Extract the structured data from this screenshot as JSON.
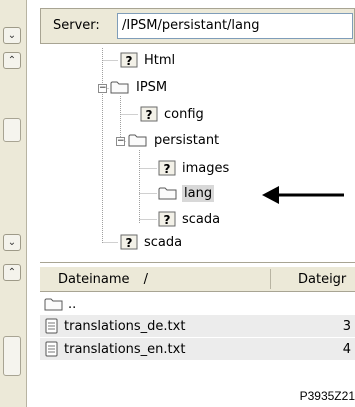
{
  "server": {
    "label": "Server:",
    "path": "/IPSM/persistant/lang"
  },
  "tree": {
    "items": [
      {
        "label": "Html",
        "icon": "unknown-type-icon"
      },
      {
        "label": "IPSM",
        "icon": "folder-icon",
        "expanded": true
      },
      {
        "label": "config",
        "icon": "unknown-type-icon"
      },
      {
        "label": "persistant",
        "icon": "folder-icon",
        "expanded": true
      },
      {
        "label": "images",
        "icon": "unknown-type-icon"
      },
      {
        "label": "lang",
        "icon": "folder-icon",
        "selected": true
      },
      {
        "label": "scada",
        "icon": "unknown-type-icon"
      },
      {
        "label": "scada",
        "icon": "unknown-type-icon"
      }
    ]
  },
  "list": {
    "columns": {
      "name": "Dateiname",
      "sort_indicator": "/",
      "type": "Dateigr"
    },
    "rows": [
      {
        "name": "..",
        "size": ""
      },
      {
        "name": "translations_de.txt",
        "size": "3"
      },
      {
        "name": "translations_en.txt",
        "size": "4"
      }
    ]
  },
  "caption": "P3935Z21"
}
